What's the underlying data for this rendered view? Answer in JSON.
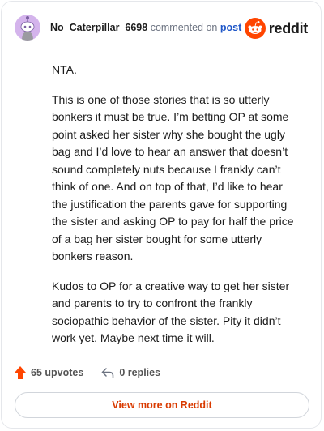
{
  "header": {
    "username": "No_Caterpillar_6698",
    "action_text": "commented on",
    "post_link": "post",
    "brand": "reddit"
  },
  "comment": {
    "paragraphs": [
      "NTA.",
      "This is one of those stories that is so utterly bonkers it must be true. I’m betting OP at some point asked her sister why she bought the ugly bag and I’d love to hear an answer that doesn’t sound completely nuts because I frankly can’t think of one. And on top of that, I’d like to hear the justification the parents gave for supporting the sister and asking OP to pay for half the price of a bag her sister bought for some utterly bonkers reason.",
      "Kudos to OP for a creative way to get her sister and parents to try to confront the frankly sociopathic behavior of the sister. Pity it didn’t work yet. Maybe next time it will."
    ]
  },
  "actions": {
    "upvotes": "65 upvotes",
    "replies": "0 replies"
  },
  "footer": {
    "view_more": "View more on Reddit"
  },
  "colors": {
    "upvote": "#ff4500",
    "link": "#1f57c8",
    "view_more": "#d93a00",
    "avatar_bg": "#d4b4ec"
  }
}
